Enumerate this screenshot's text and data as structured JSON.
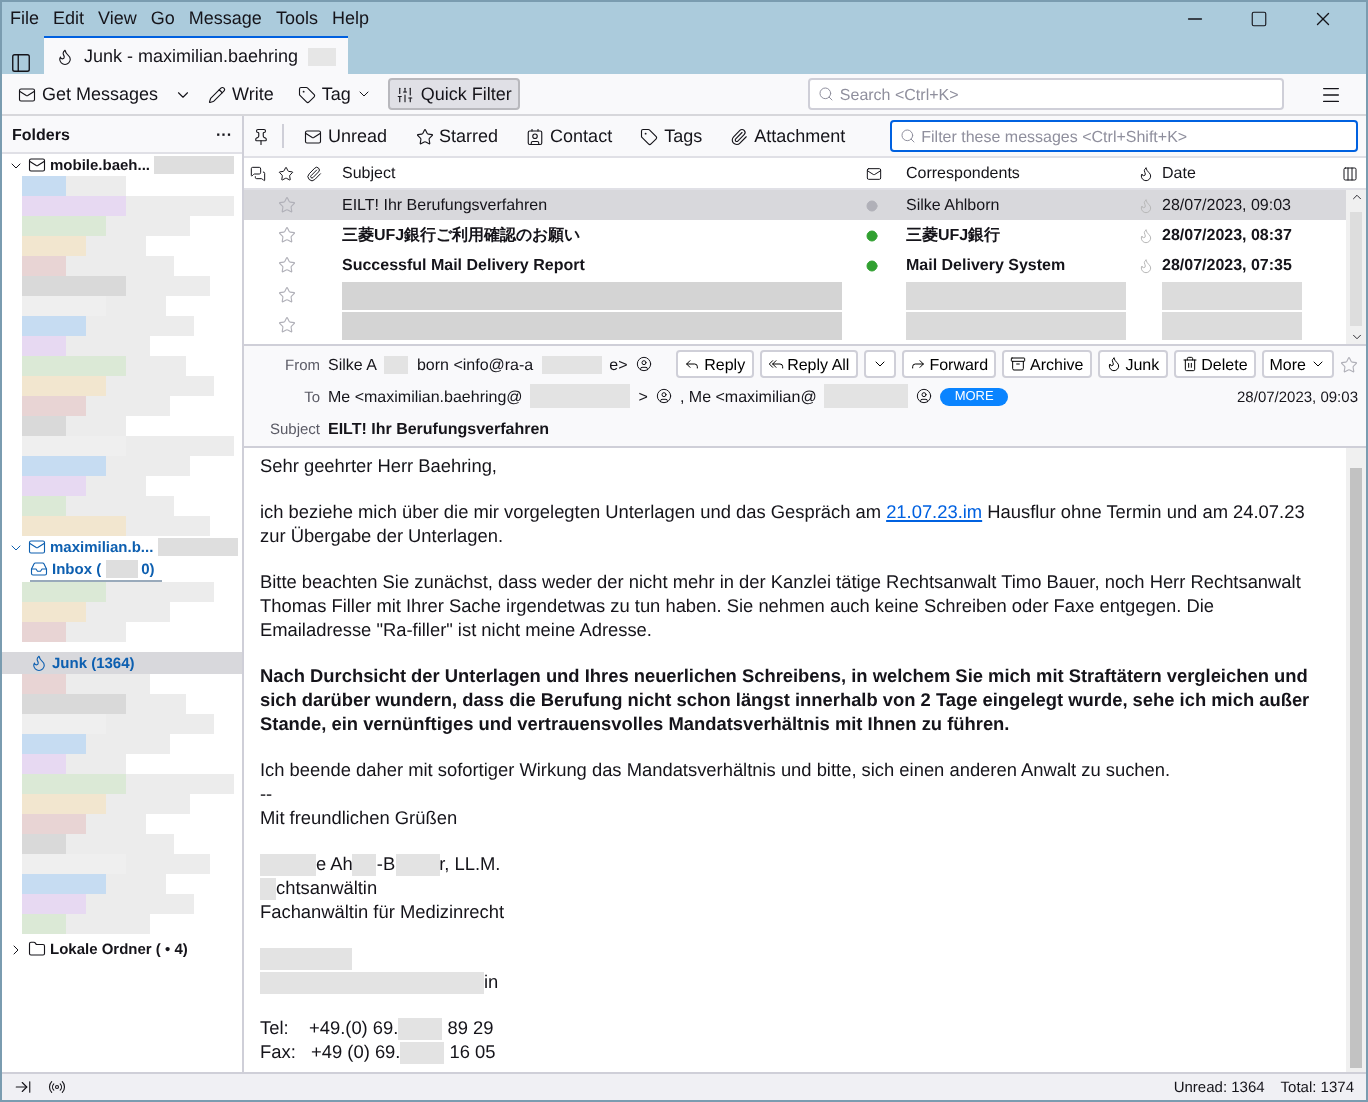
{
  "menu": [
    "File",
    "Edit",
    "View",
    "Go",
    "Message",
    "Tools",
    "Help"
  ],
  "tab": {
    "title": "Junk - maximilian.baehring"
  },
  "toolbar": {
    "buttons": [
      {
        "label": "Get Messages",
        "kind": "get",
        "pressed": false
      },
      {
        "label": "Write",
        "kind": "write",
        "pressed": false
      },
      {
        "label": "Tag",
        "kind": "tag",
        "pressed": false
      },
      {
        "label": "Quick Filter",
        "kind": "filter",
        "pressed": true
      }
    ],
    "search": {
      "placeholder": "Search <Ctrl+K>"
    }
  },
  "folders": {
    "title": "Folders",
    "more": "···",
    "accounts": [
      {
        "name": "mobile.baeh...",
        "expanded": true
      },
      {
        "name": "maximilian.b...",
        "expanded": true,
        "children": [
          {
            "name": "Inbox (",
            "suffix": "0)",
            "kind": "inbox",
            "selected": false
          },
          {
            "name": "Junk (1364)",
            "kind": "junk",
            "selected": true
          }
        ]
      },
      {
        "name": "Lokale Ordner ( • 4)",
        "expanded": false
      }
    ]
  },
  "quick_filter": {
    "buttons": [
      {
        "label": "Unread",
        "kind": "unread"
      },
      {
        "label": "Starred",
        "kind": "star"
      },
      {
        "label": "Contact",
        "kind": "contact"
      },
      {
        "label": "Tags",
        "kind": "tag"
      },
      {
        "label": "Attachment",
        "kind": "attach"
      }
    ],
    "search": {
      "placeholder": "Filter these messages <Ctrl+Shift+K>"
    }
  },
  "columns": {
    "subject": "Subject",
    "correspondents": "Correspondents",
    "date": "Date"
  },
  "messages": [
    {
      "subject": "EILT! Ihr Berufungsverfahren",
      "correspondent": "Silke Ahlborn",
      "date": "28/07/2023, 09:03",
      "read": true,
      "selected": true
    },
    {
      "subject": "三菱UFJ銀行ご利用確認のお願い",
      "correspondent": "三菱UFJ銀行",
      "date": "28/07/2023, 08:37",
      "read": false,
      "selected": false
    },
    {
      "subject": "Successful Mail Delivery Report",
      "correspondent": "Mail Delivery System",
      "date": "28/07/2023, 07:35",
      "read": false,
      "selected": false
    }
  ],
  "header": {
    "from_label": "From",
    "from": [
      "Silke A",
      "born <info@ra-a",
      "e>"
    ],
    "to_label": "To",
    "to": [
      "Me <maximilian.baehring@",
      ">",
      ", Me <maximilian@"
    ],
    "more_badge": "MORE",
    "subject_label": "Subject",
    "subject": "EILT! Ihr Berufungsverfahren",
    "date": "28/07/2023, 09:03",
    "buttons": [
      {
        "label": "Reply",
        "kind": "reply"
      },
      {
        "label": "Reply All",
        "kind": "replyall"
      },
      {
        "label": "Forward",
        "kind": "forward"
      },
      {
        "label": "Archive",
        "kind": "archive"
      },
      {
        "label": "Junk",
        "kind": "junk"
      },
      {
        "label": "Delete",
        "kind": "delete"
      },
      {
        "label": "More",
        "kind": "more"
      }
    ]
  },
  "body": [
    {
      "kind": "text",
      "parts": [
        {
          "text": "Sehr geehrter Herr Baehring,"
        }
      ]
    },
    {
      "kind": "text",
      "parts": [
        {
          "text": "ich beziehe mich über die mir vorgelegten Unterlagen und das Gespräch am "
        },
        {
          "text": "21.07.23.im",
          "link": true
        },
        {
          "text": " Hausflur  ohne Termin und am 24.07.23 zur Übergabe der Unterlagen."
        }
      ]
    },
    {
      "kind": "text",
      "parts": [
        {
          "text": "Bitte beachten Sie zunächst, dass weder der nicht mehr in der Kanzlei tätige Rechtsanwalt Timo Bauer, noch Herr Rechtsanwalt Thomas Filler mit Ihrer Sache irgendetwas zu tun haben. Sie nehmen auch keine Schreiben oder Faxe entgegen. Die Emailadresse \"Ra-filler\" ist nicht meine Adresse."
        }
      ]
    },
    {
      "kind": "bold",
      "parts": [
        {
          "text": "Nach Durchsicht der Unterlagen und Ihres neuerlichen Schreibens, in welchem Sie mich mit Straftätern vergleichen und sich darüber wundern, dass die Berufung nicht schon längst innerhalb von 2 Tage  eingelegt wurde, sehe ich mich außer Stande, ein vernünftiges und vertrauensvolles Mandatsverhältnis mit Ihnen zu führen."
        }
      ]
    },
    {
      "kind": "lines",
      "lines": [
        [
          {
            "text": "Ich beende daher mit sofortiger Wirkung das Mandatsverhältnis und bitte, sich einen anderen Anwalt zu suchen."
          }
        ],
        [
          {
            "text": "--"
          }
        ],
        [
          {
            "text": "Mit freundlichen Grüßen"
          }
        ]
      ]
    },
    {
      "kind": "lines",
      "lines": [
        [
          {
            "kind": "blur"
          },
          {
            "text": "e Ah"
          },
          {
            "kind": "blur"
          },
          {
            "text": "-B"
          },
          {
            "kind": "blur"
          },
          {
            "text": "r, LL.M."
          }
        ],
        [
          {
            "kind": "blur"
          },
          {
            "text": "chtsanwältin"
          }
        ],
        [
          {
            "text": "Fachanwältin für Medizinrecht"
          }
        ]
      ]
    },
    {
      "kind": "lines",
      "lines": [
        [
          {
            "kind": "blur"
          }
        ],
        [
          {
            "kind": "blur"
          },
          {
            "text": "in"
          }
        ]
      ]
    },
    {
      "kind": "lines",
      "lines": [
        [
          {
            "text": "Tel:    +49.(0) 69."
          },
          {
            "kind": "blur"
          },
          {
            "text": " 89 29"
          }
        ],
        [
          {
            "text": "Fax:   +49 (0) 69."
          },
          {
            "kind": "blur"
          },
          {
            "text": " 16 05"
          }
        ]
      ]
    }
  ],
  "status": {
    "unread": "Unread: 1364",
    "total": "Total: 1374"
  }
}
